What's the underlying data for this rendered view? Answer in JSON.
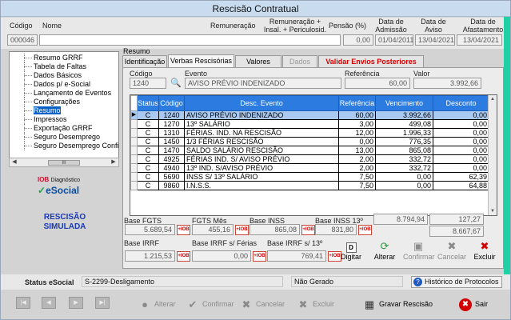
{
  "window": {
    "title": "Rescisão Contratual"
  },
  "header": {
    "labels": {
      "codigo": "Código",
      "nome": "Nome",
      "remuneracao": "Remuneração",
      "remuneracao_insal": "Remuneração + Insal. + Periculosid.",
      "pensao": "Pensão (%)",
      "admissao": "Data de Admissão",
      "aviso": "Data de Aviso",
      "afastamento": "Data de Afastamento"
    },
    "values": {
      "codigo": "000046",
      "nome": "",
      "pensao": "0,00",
      "admissao": "01/04/2011",
      "aviso": "13/04/2021",
      "afastamento": "13/04/2021"
    }
  },
  "sidebar": {
    "items": [
      {
        "label": "Resumo GRRF"
      },
      {
        "label": "Tabela de Faltas"
      },
      {
        "label": "Dados Básicos"
      },
      {
        "label": "Dados p/ e-Social"
      },
      {
        "label": "Lançamento de Eventos"
      },
      {
        "label": "Configurações"
      },
      {
        "label": "Resumo"
      },
      {
        "label": "Impressos"
      },
      {
        "label": "Exportação GRRF"
      },
      {
        "label": "Seguro Desemprego"
      },
      {
        "label": "Seguro Desemprego Confi"
      }
    ],
    "selected": "Resumo",
    "scroll_thumb": "III"
  },
  "brand": {
    "top": "IOB",
    "top_small": "Diagnóstico",
    "bottom": "eSocial"
  },
  "simulation": {
    "line1": "RESCISÃO",
    "line2": "SIMULADA"
  },
  "main": {
    "section_label": "Resumo",
    "tabs": [
      {
        "label": "Identificação",
        "state": "normal"
      },
      {
        "label": "Verbas Rescisórias",
        "state": "active"
      },
      {
        "label": "Valores FGTS",
        "state": "normal"
      },
      {
        "label": "Dados PLR",
        "state": "disabled"
      },
      {
        "label": "Validar Envios Posteriores",
        "state": "alert"
      }
    ],
    "event_fields": {
      "codigo_label": "Código",
      "evento_label": "Evento",
      "referencia_label": "Referência",
      "valor_label": "Valor",
      "codigo": "1240",
      "evento": "AVISO PRÉVIO INDENIZADO",
      "referencia": "60,00",
      "valor": "3.992,66"
    },
    "table": {
      "columns": [
        "Status",
        "Código",
        "Desc. Evento",
        "Referência",
        "Vencimento",
        "Desconto"
      ],
      "rows": [
        [
          "C",
          "1240",
          "AVISO PRÉVIO INDENIZADO",
          "60,00",
          "3.992,66",
          "0,00"
        ],
        [
          "C",
          "1270",
          "13º SALÁRIO",
          "3,00",
          "499,08",
          "0,00"
        ],
        [
          "C",
          "1310",
          "FÉRIAS. IND. NA RESCISÃO",
          "12,00",
          "1.996,33",
          "0,00"
        ],
        [
          "C",
          "1450",
          "1/3 FÉRIAS RESCISÃO",
          "0,00",
          "776,35",
          "0,00"
        ],
        [
          "C",
          "1470",
          "SALDO SALÁRIO RESCISÃO",
          "13,00",
          "865,08",
          "0,00"
        ],
        [
          "C",
          "4925",
          "FÉRIAS IND. S/ AVISO PRÉVIO",
          "2,00",
          "332,72",
          "0,00"
        ],
        [
          "C",
          "4940",
          "13º IND. S/AVISO PRÉVIO",
          "2,00",
          "332,72",
          "0,00"
        ],
        [
          "C",
          "5690",
          "INSS S/ 13º SALÁRIO",
          "7,50",
          "0,00",
          "62,39"
        ],
        [
          "C",
          "9860",
          "I.N.S.S.",
          "7,50",
          "0,00",
          "64,88"
        ]
      ]
    },
    "bases": {
      "base_fgts_label": "Base FGTS",
      "base_fgts": "5.689,54",
      "fgts_mes_label": "FGTS Mês",
      "fgts_mes": "455,16",
      "base_inss_label": "Base INSS",
      "base_inss": "865,08",
      "base_inss13_label": "Base INSS 13º",
      "base_inss13": "831,80",
      "total_vencimento": "8.794,94",
      "total_desconto": "127,27",
      "liquido": "8.667,67",
      "base_irrf_label": "Base IRRF",
      "base_irrf": "1.215,53",
      "base_irrf_ferias_label": "Base IRRF s/ Férias",
      "base_irrf_ferias": "0,00",
      "base_irrf_13_label": "Base IRRF s/ 13º",
      "base_irrf_13": "769,41",
      "ioe_label": "+IOB"
    },
    "actions": {
      "digitar": "Digitar",
      "digitar_key": "D",
      "alterar": "Alterar",
      "confirmar": "Confirmar",
      "cancelar": "Cancelar",
      "excluir": "Excluir"
    }
  },
  "status": {
    "label": "Status eSocial",
    "event": "S-2299-Desligamento",
    "state": "Não Gerado",
    "historico": "Histórico de Protocolos"
  },
  "bottom_buttons": {
    "alterar": "Alterar",
    "confirmar": "Confirmar",
    "cancelar": "Cancelar",
    "excluir": "Excluir",
    "gravar": "Gravar Rescisão",
    "sair": "Sair"
  },
  "colors": {
    "accent": "#2b7be1",
    "selection": "#0a62c7",
    "alert": "#d30000",
    "side_strip": "#1fd1a3"
  }
}
